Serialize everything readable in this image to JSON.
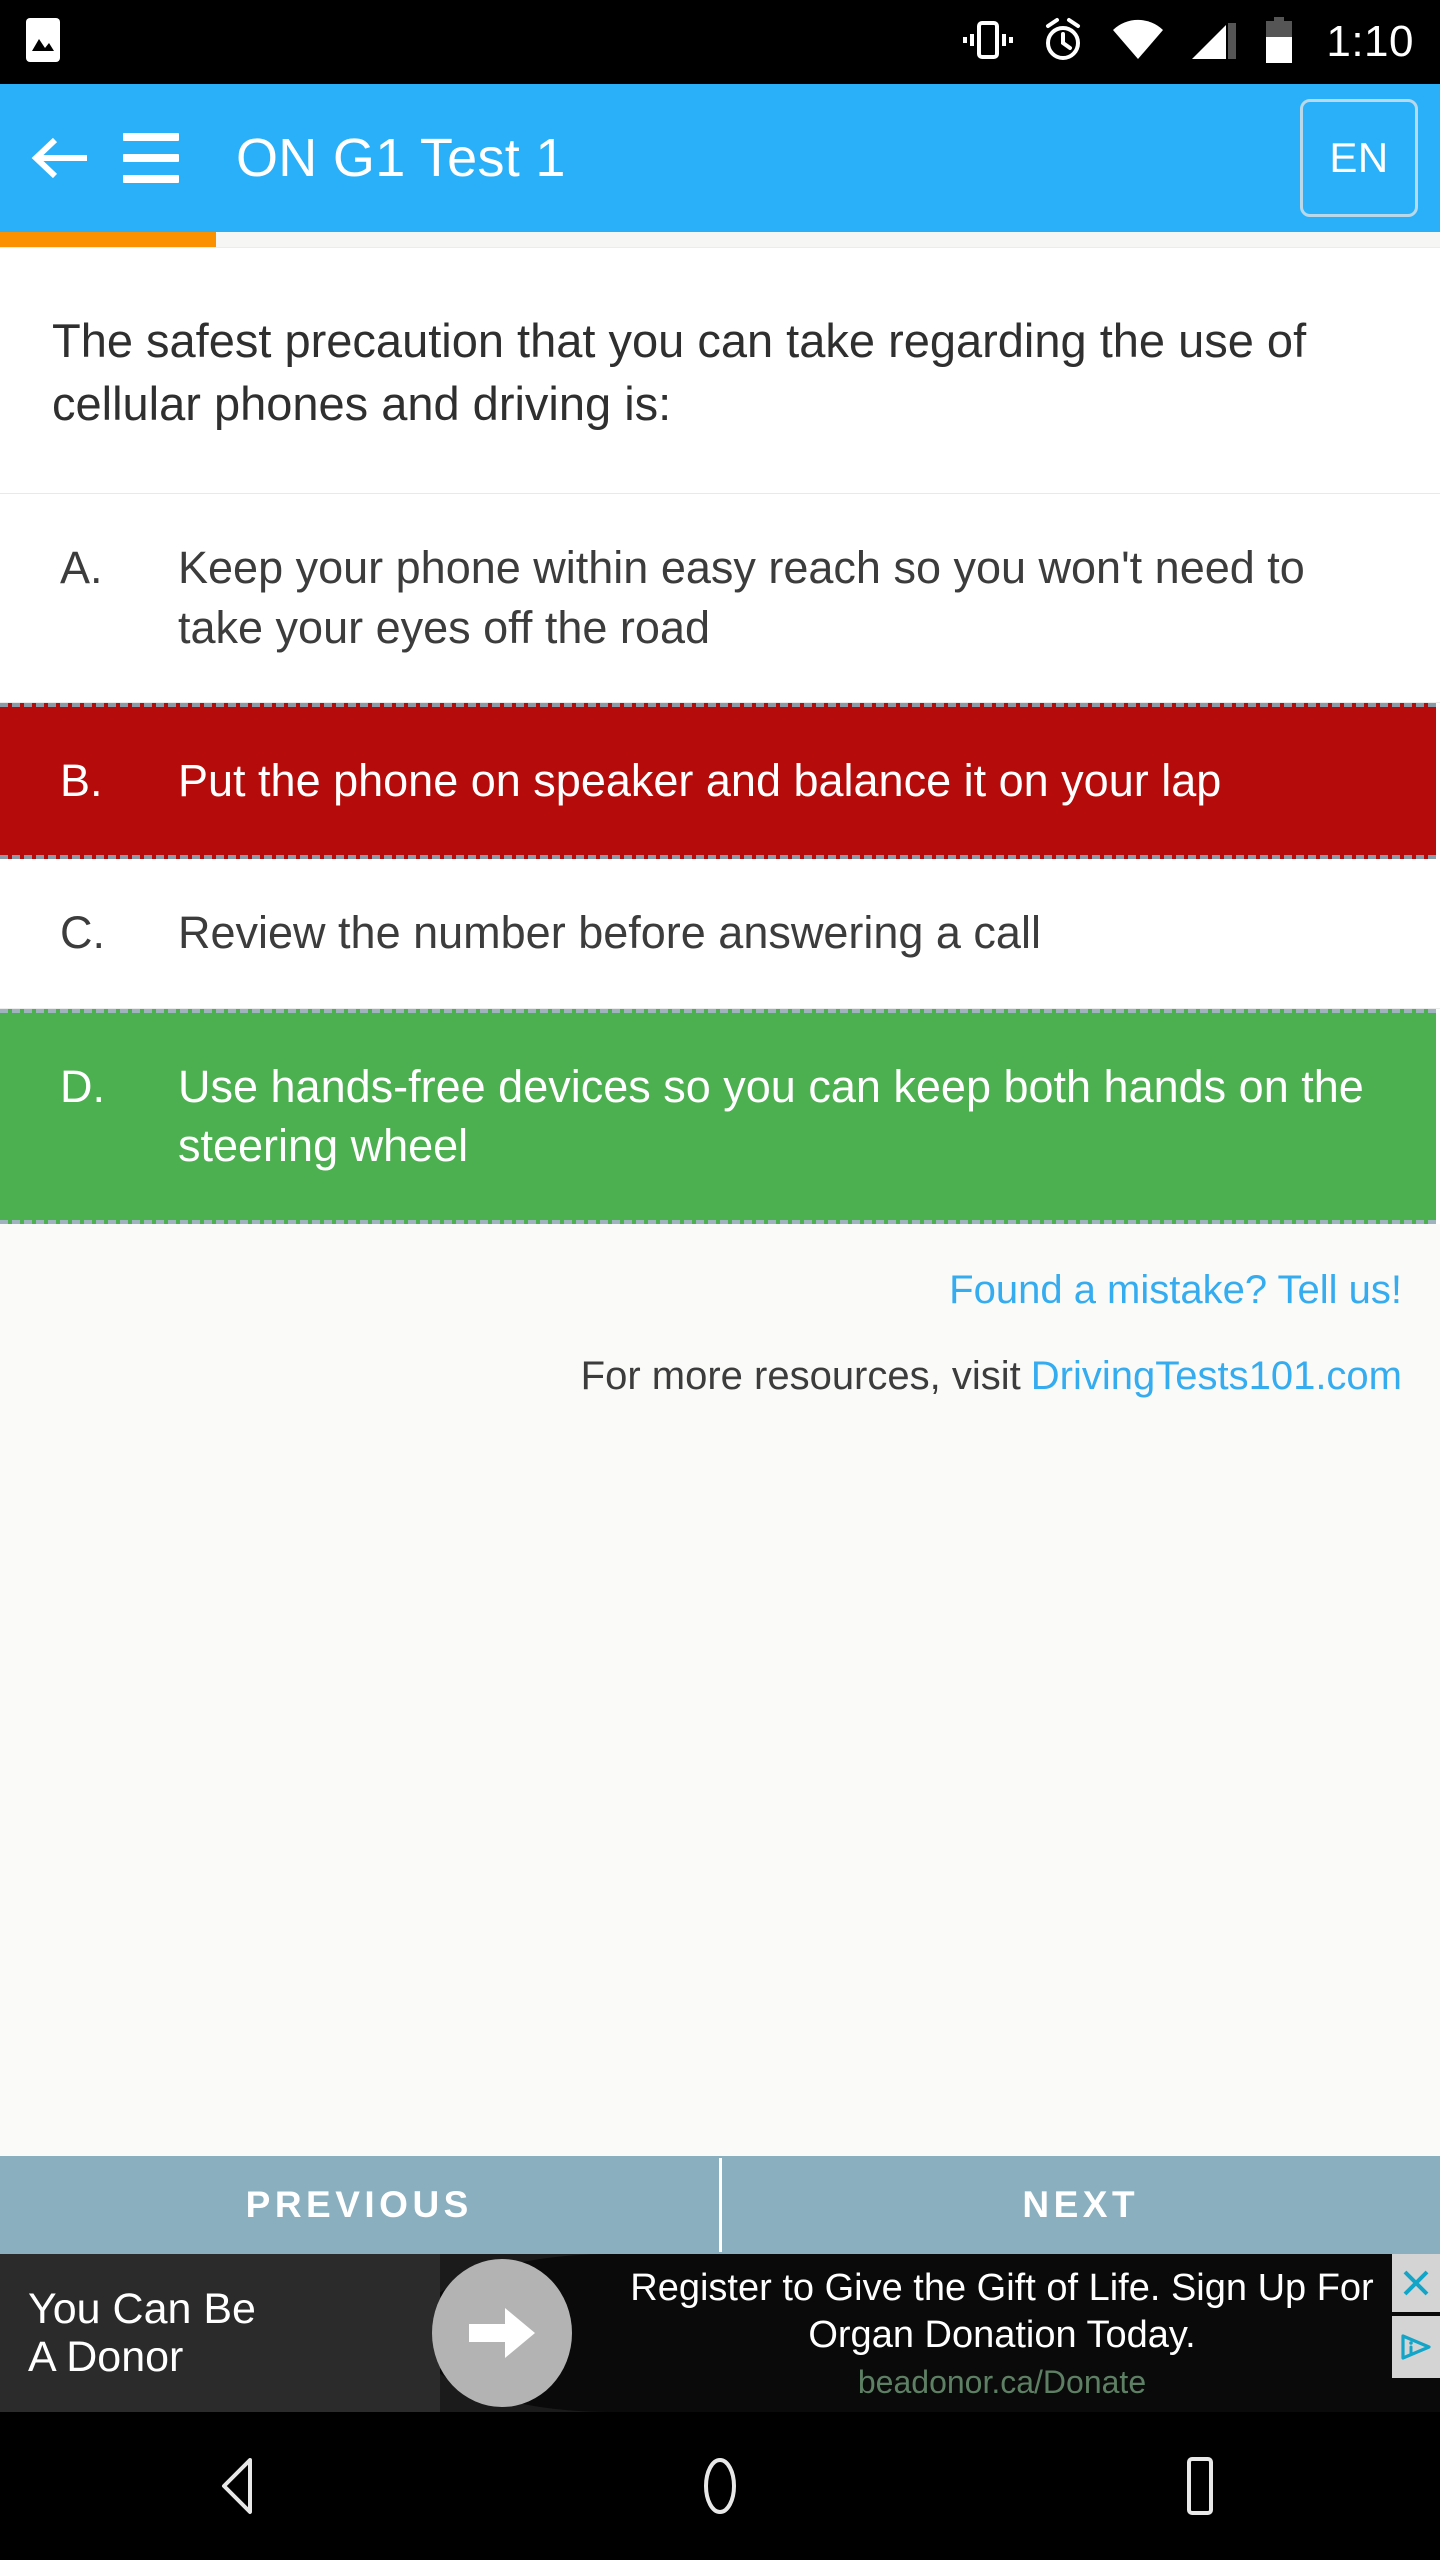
{
  "status_bar": {
    "icons": [
      "photo-icon",
      "vibrate-icon",
      "alarm-icon",
      "wifi-icon",
      "cell-signal-icon",
      "battery-icon"
    ],
    "time": "1:10"
  },
  "app_bar": {
    "back_icon": "back-arrow-icon",
    "menu_icon": "hamburger-menu-icon",
    "title": "ON G1 Test 1",
    "language": "EN",
    "accent_color": "#29b0f8"
  },
  "progress": {
    "percent": 15,
    "fill_color": "#fb9100",
    "track_color": "#f6f6f4"
  },
  "question": {
    "text": "The safest precaution that you can take regarding the use of cellular phones and driving is:"
  },
  "answers": [
    {
      "letter": "A.",
      "text": "Keep your phone within easy reach so you won't need to take your eyes off the road",
      "state": "neutral"
    },
    {
      "letter": "B.",
      "text": "Put the phone on speaker and balance it on your lap",
      "state": "wrong"
    },
    {
      "letter": "C.",
      "text": "Review the number before answering a call",
      "state": "neutral"
    },
    {
      "letter": "D.",
      "text": "Use hands-free devices so you can keep both hands on the steering wheel",
      "state": "correct"
    }
  ],
  "answer_colors": {
    "wrong": "#b50b0b",
    "correct": "#4caf50",
    "neutral": "#ffffff"
  },
  "links": {
    "mistake": "Found a mistake? Tell us!",
    "resources_prefix": "For more resources, visit",
    "resources_site": "DrivingTests101.com",
    "link_color": "#35acf0"
  },
  "bottom_nav": {
    "previous": "PREVIOUS",
    "next": "NEXT",
    "background_color": "#8aafbe"
  },
  "ad": {
    "left_line1": "You Can Be",
    "left_line2": "A Donor",
    "arrow_icon": "arrow-right-icon",
    "headline": "Register to Give the Gift of Life. Sign Up For Organ Donation Today.",
    "url": "beadonor.ca/Donate",
    "close_icon": "close-icon",
    "adchoices_icon": "adchoices-icon"
  },
  "android_nav": {
    "back_icon": "nav-back-icon",
    "home_icon": "nav-home-icon",
    "recents_icon": "nav-recents-icon"
  }
}
